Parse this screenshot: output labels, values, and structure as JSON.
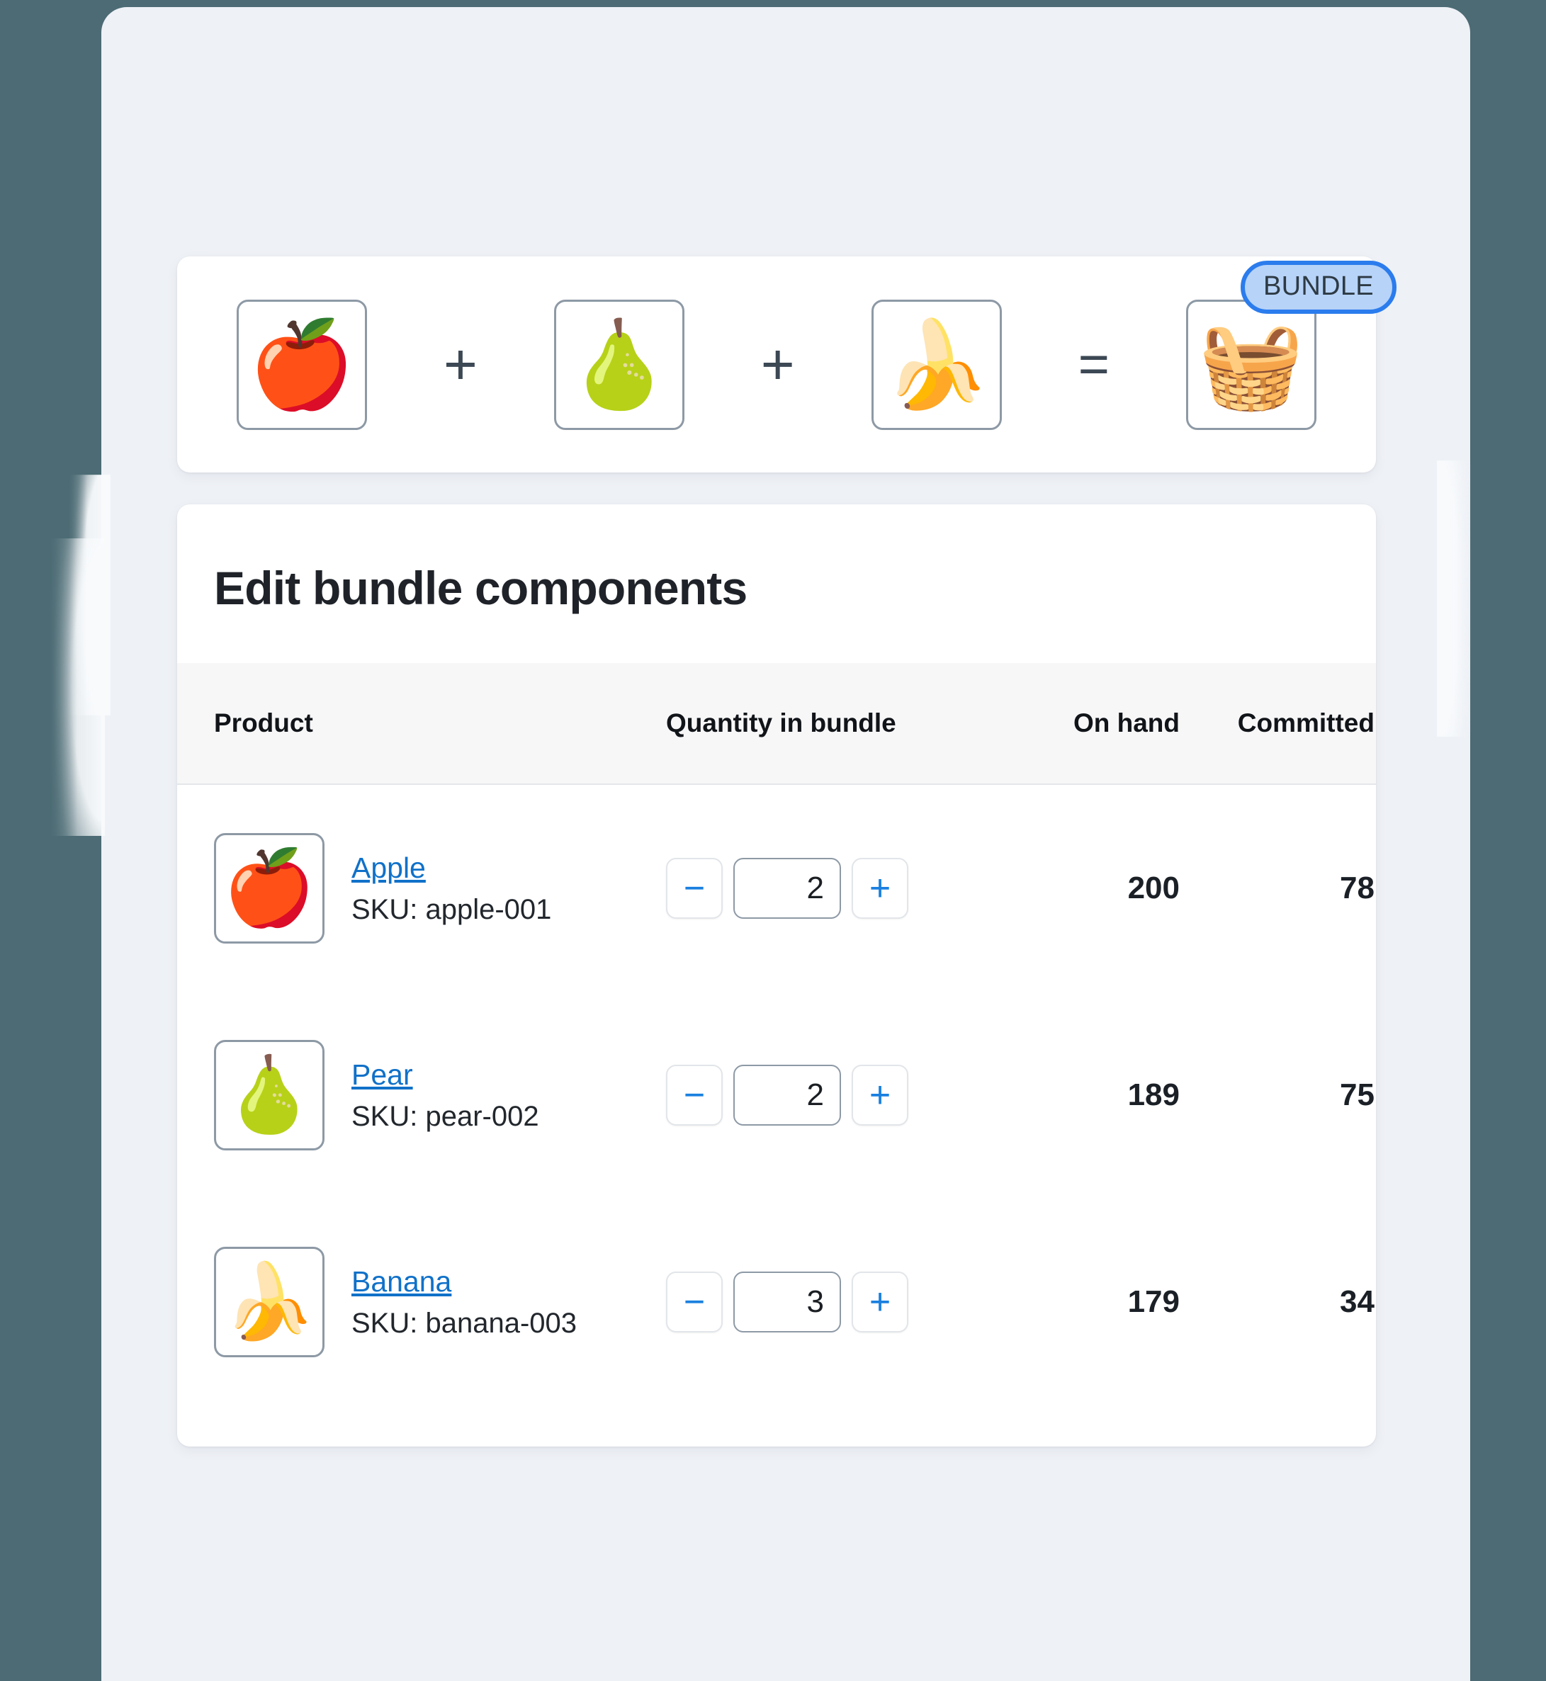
{
  "bundle_equation": {
    "items": [
      {
        "name": "Apple",
        "icon": "apple-image",
        "glyph": "🍎"
      },
      {
        "name": "Pear",
        "icon": "pear-image",
        "glyph": "🍐"
      },
      {
        "name": "Banana",
        "icon": "banana-image",
        "glyph": "🍌"
      }
    ],
    "result": {
      "name": "Fruit bundle",
      "icon": "fruit-basket-image",
      "glyph": "🧺"
    },
    "plus_symbol": "+",
    "equals_symbol": "=",
    "badge_label": "BUNDLE"
  },
  "components": {
    "title": "Edit bundle components",
    "columns": [
      "Product",
      "Quantity in bundle",
      "On hand",
      "Committed"
    ],
    "rows": [
      {
        "glyph": "🍎",
        "icon": "apple-image",
        "name": "Apple",
        "sku": "SKU: apple-001",
        "quantity": "2",
        "on_hand": "200",
        "committed": "78",
        "decrement_label": "−",
        "increment_label": "+"
      },
      {
        "glyph": "🍐",
        "icon": "pear-image",
        "name": "Pear",
        "sku": "SKU: pear-002",
        "quantity": "2",
        "on_hand": "189",
        "committed": "75",
        "decrement_label": "−",
        "increment_label": "+"
      },
      {
        "glyph": "🍌",
        "icon": "banana-image",
        "name": "Banana",
        "sku": "SKU: banana-003",
        "quantity": "3",
        "on_hand": "179",
        "committed": "34",
        "decrement_label": "−",
        "increment_label": "+"
      }
    ]
  },
  "colors": {
    "canvas": "#4c6b74",
    "page_background": "#eef1f6",
    "card": "#ffffff",
    "link_blue": "#1071c9",
    "accent_blue": "#2b7ced",
    "badge_fill": "#b7d3f8",
    "header_row": "#f7f7f8",
    "text_dark": "#1f2329",
    "thumb_border": "#8d99a5"
  }
}
